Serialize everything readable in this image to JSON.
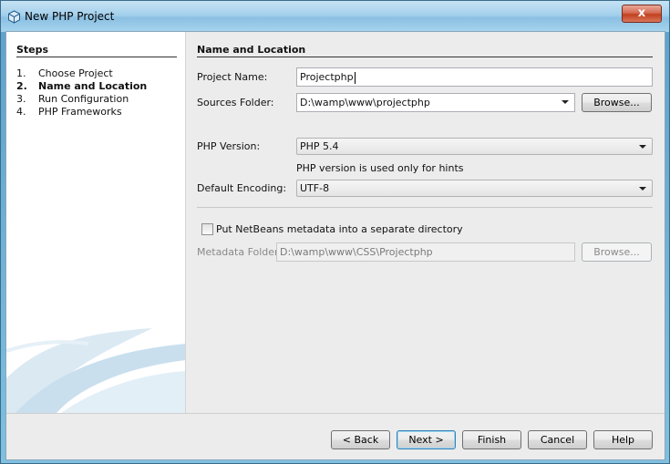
{
  "window": {
    "title": "New PHP Project",
    "close_label": "x"
  },
  "steps": {
    "title": "Steps",
    "items": [
      {
        "num": "1.",
        "label": "Choose Project"
      },
      {
        "num": "2.",
        "label": "Name and Location"
      },
      {
        "num": "3.",
        "label": "Run Configuration"
      },
      {
        "num": "4.",
        "label": "PHP Frameworks"
      }
    ],
    "current_index": 1
  },
  "form": {
    "section_title": "Name and Location",
    "project_name": {
      "label": "Project Name:",
      "value": "Projectphp"
    },
    "sources_folder": {
      "label": "Sources Folder:",
      "value": "D:\\wamp\\www\\projectphp",
      "browse_label": "Browse..."
    },
    "php_version": {
      "label": "PHP Version:",
      "value": "PHP 5.4",
      "hint": "PHP version is used only for hints"
    },
    "default_encoding": {
      "label": "Default Encoding:",
      "value": "UTF-8"
    },
    "metadata_checkbox": {
      "label": "Put NetBeans metadata into a separate directory",
      "checked": false
    },
    "metadata_folder": {
      "label": "Metadata Folder:",
      "value": "D:\\wamp\\www\\CSS\\Projectphp",
      "browse_label": "Browse..."
    }
  },
  "footer": {
    "back_label": "< Back",
    "next_label": "Next >",
    "finish_label": "Finish",
    "cancel_label": "Cancel",
    "help_label": "Help"
  },
  "colors": {
    "titlebar": "#a4d0ec",
    "close_button": "#c2401f",
    "default_button_border": "#3c7fb1"
  }
}
